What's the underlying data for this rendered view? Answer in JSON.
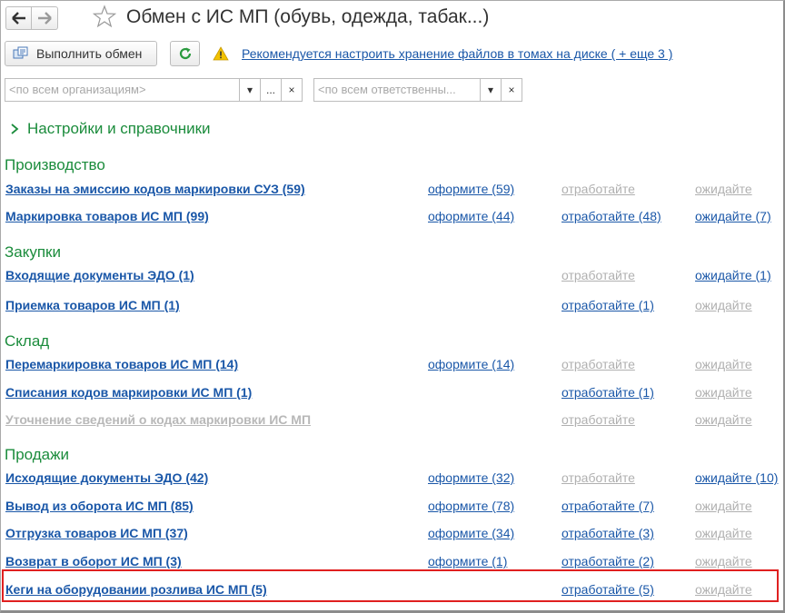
{
  "window": {
    "title": "Обмен с ИС МП (обувь, одежда, табак...)"
  },
  "toolbar": {
    "exchange_label": "Выполнить обмен",
    "warning_link": "Рекомендуется настроить хранение файлов в томах на диске ( + еще 3 )"
  },
  "filters": {
    "org_placeholder": "<по всем организациям>",
    "resp_placeholder": "<по всем ответственны...",
    "ellipsis": "...",
    "dropdown": "▾",
    "clear": "×"
  },
  "settings_group": {
    "label": "Настройки и справочники"
  },
  "colors": {
    "link": "#1a57a8",
    "section": "#1b8c3c",
    "muted": "#b0b0b0",
    "highlight": "#e02020"
  },
  "icons": [
    "back-arrow-icon",
    "forward-arrow-icon",
    "favorite-star-icon",
    "exchange-icon",
    "refresh-icon",
    "warning-icon",
    "chevron-right-icon"
  ],
  "sections": [
    {
      "title": "Производство",
      "rows": [
        {
          "label": "Заказы на эмиссию кодов маркировки СУЗ (59)",
          "c1": "оформите (59)",
          "c2": "отработайте",
          "c3": "ожидайте"
        },
        {
          "label": "Маркировка товаров ИС МП (99)",
          "c1": "оформите (44)",
          "c2": "отработайте (48)",
          "c3": "ожидайте (7)"
        }
      ]
    },
    {
      "title": "Закупки",
      "rows": [
        {
          "label": "Входящие документы ЭДО (1)",
          "c2": "отработайте",
          "c3": "ожидайте (1)"
        },
        {
          "label": "Приемка товаров ИС МП (1)",
          "c2": "отработайте (1)",
          "c3": "ожидайте"
        }
      ]
    },
    {
      "title": "Склад",
      "rows": [
        {
          "label": "Перемаркировка товаров ИС МП (14)",
          "c1": "оформите (14)",
          "c2": "отработайте",
          "c3": "ожидайте"
        },
        {
          "label": "Списания кодов маркировки ИС МП (1)",
          "c2": "отработайте (1)",
          "c3": "ожидайте"
        },
        {
          "label": "Уточнение сведений о кодах маркировки ИС МП",
          "c2": "отработайте",
          "c3": "ожидайте"
        }
      ]
    },
    {
      "title": "Продажи",
      "rows": [
        {
          "label": "Исходящие документы ЭДО (42)",
          "c1": "оформите (32)",
          "c2": "отработайте",
          "c3": "ожидайте (10)"
        },
        {
          "label": "Вывод из оборота ИС МП (85)",
          "c1": "оформите (78)",
          "c2": "отработайте (7)",
          "c3": "ожидайте"
        },
        {
          "label": "Отгрузка товаров ИС МП (37)",
          "c1": "оформите (34)",
          "c2": "отработайте (3)",
          "c3": "ожидайте"
        },
        {
          "label": "Возврат в оборот ИС МП (3)",
          "c1": "оформите (1)",
          "c2": "отработайте (2)",
          "c3": "ожидайте"
        },
        {
          "label": "Кеги на оборудовании розлива ИС МП (5)",
          "c2": "отработайте (5)",
          "c3": "ожидайте"
        }
      ]
    }
  ]
}
